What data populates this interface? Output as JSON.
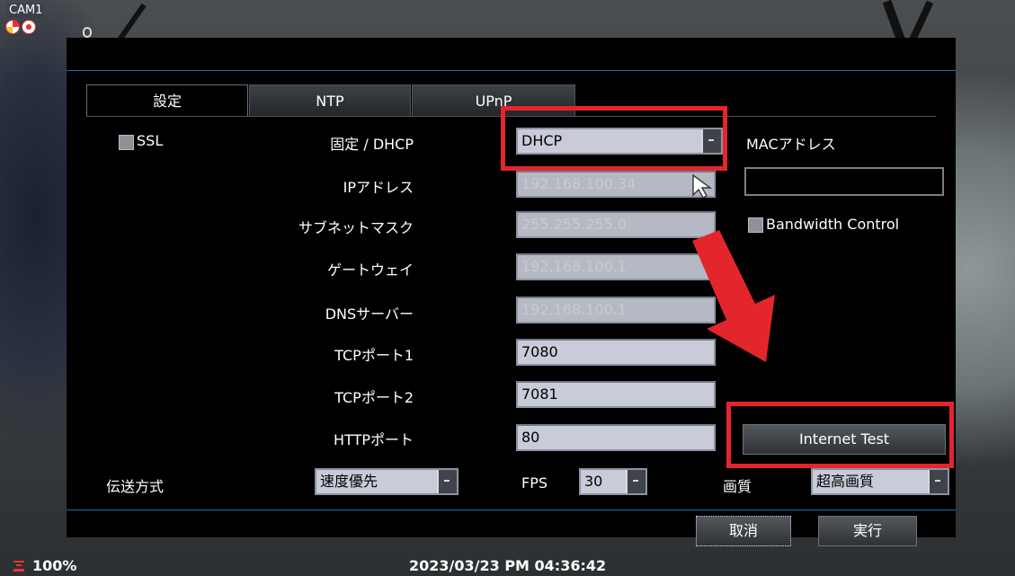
{
  "camera": {
    "label": "CAM1"
  },
  "tabs": [
    {
      "label": "設定",
      "active": true
    },
    {
      "label": "NTP",
      "active": false
    },
    {
      "label": "UPnP",
      "active": false
    }
  ],
  "ssl": {
    "label": "SSL",
    "checked": false
  },
  "fields": {
    "mode": {
      "label": "固定 / DHCP",
      "value": "DHCP"
    },
    "ip": {
      "label": "IPアドレス",
      "value": "192.168.100.34"
    },
    "subnet": {
      "label": "サブネットマスク",
      "value": "255.255.255.0"
    },
    "gateway": {
      "label": "ゲートウェイ",
      "value": "192.168.100.1"
    },
    "dns": {
      "label": "DNSサーバー",
      "value": "192.168.100.1"
    },
    "tcp1": {
      "label": "TCPポート1",
      "value": "7080"
    },
    "tcp2": {
      "label": "TCPポート2",
      "value": "7081"
    },
    "http": {
      "label": "HTTPポート",
      "value": "80"
    }
  },
  "mac": {
    "label": "MACアドレス",
    "value": ""
  },
  "bandwidth": {
    "label": "Bandwidth Control",
    "checked": false
  },
  "internet_test": {
    "label": "Internet Test"
  },
  "transfer": {
    "label": "伝送方式",
    "value": "速度優先",
    "fps_label": "FPS",
    "fps_value": "30",
    "quality_label": "画質",
    "quality_value": "超高画質"
  },
  "actions": {
    "cancel": "取消",
    "execute": "実行"
  },
  "status": {
    "zoom": "100%",
    "datetime": "2023/03/23 PM 04:36:42"
  },
  "colors": {
    "highlight": "#e3262c",
    "accent_line": "#1f6fb0"
  }
}
